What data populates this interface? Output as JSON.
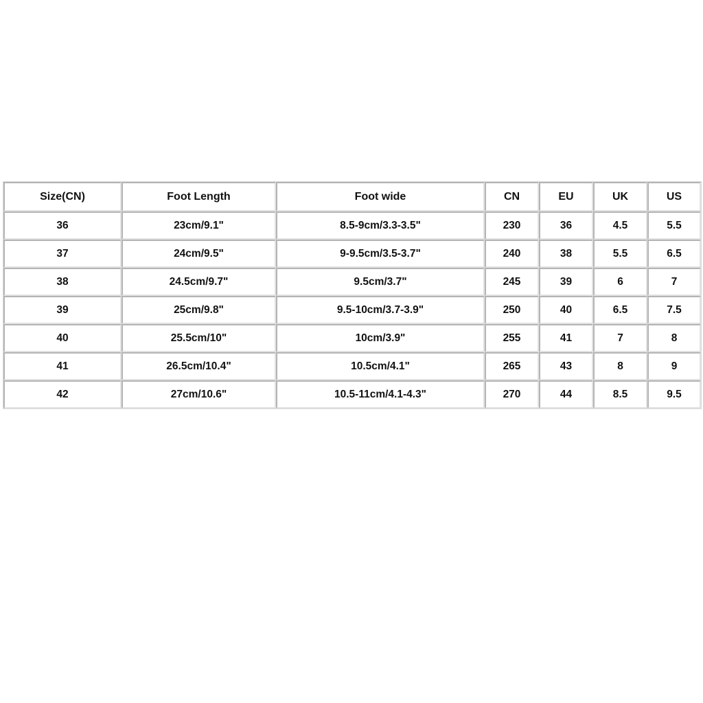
{
  "page": {
    "background_color": "#ffffff",
    "content_type": "shoe-size-conversion-chart"
  },
  "size_chart": {
    "border_color": "#b4b4b4",
    "cell_background": "#ffffff",
    "text_color": "#111111",
    "columns": [
      {
        "key": "size_cn",
        "label": "Size(CN)"
      },
      {
        "key": "foot_length",
        "label": "Foot Length"
      },
      {
        "key": "foot_wide",
        "label": "Foot wide"
      },
      {
        "key": "cn",
        "label": "CN"
      },
      {
        "key": "eu",
        "label": "EU"
      },
      {
        "key": "uk",
        "label": "UK"
      },
      {
        "key": "us",
        "label": "US"
      }
    ],
    "rows": [
      {
        "size_cn": "36",
        "foot_length": "23cm/9.1\"",
        "foot_wide": "8.5-9cm/3.3-3.5\"",
        "cn": "230",
        "eu": "36",
        "uk": "4.5",
        "us": "5.5"
      },
      {
        "size_cn": "37",
        "foot_length": "24cm/9.5\"",
        "foot_wide": "9-9.5cm/3.5-3.7\"",
        "cn": "240",
        "eu": "38",
        "uk": "5.5",
        "us": "6.5"
      },
      {
        "size_cn": "38",
        "foot_length": "24.5cm/9.7\"",
        "foot_wide": "9.5cm/3.7\"",
        "cn": "245",
        "eu": "39",
        "uk": "6",
        "us": "7"
      },
      {
        "size_cn": "39",
        "foot_length": "25cm/9.8\"",
        "foot_wide": "9.5-10cm/3.7-3.9\"",
        "cn": "250",
        "eu": "40",
        "uk": "6.5",
        "us": "7.5"
      },
      {
        "size_cn": "40",
        "foot_length": "25.5cm/10\"",
        "foot_wide": "10cm/3.9\"",
        "cn": "255",
        "eu": "41",
        "uk": "7",
        "us": "8"
      },
      {
        "size_cn": "41",
        "foot_length": "26.5cm/10.4\"",
        "foot_wide": "10.5cm/4.1\"",
        "cn": "265",
        "eu": "43",
        "uk": "8",
        "us": "9"
      },
      {
        "size_cn": "42",
        "foot_length": "27cm/10.6\"",
        "foot_wide": "10.5-11cm/4.1-4.3\"",
        "cn": "270",
        "eu": "44",
        "uk": "8.5",
        "us": "9.5"
      }
    ]
  }
}
